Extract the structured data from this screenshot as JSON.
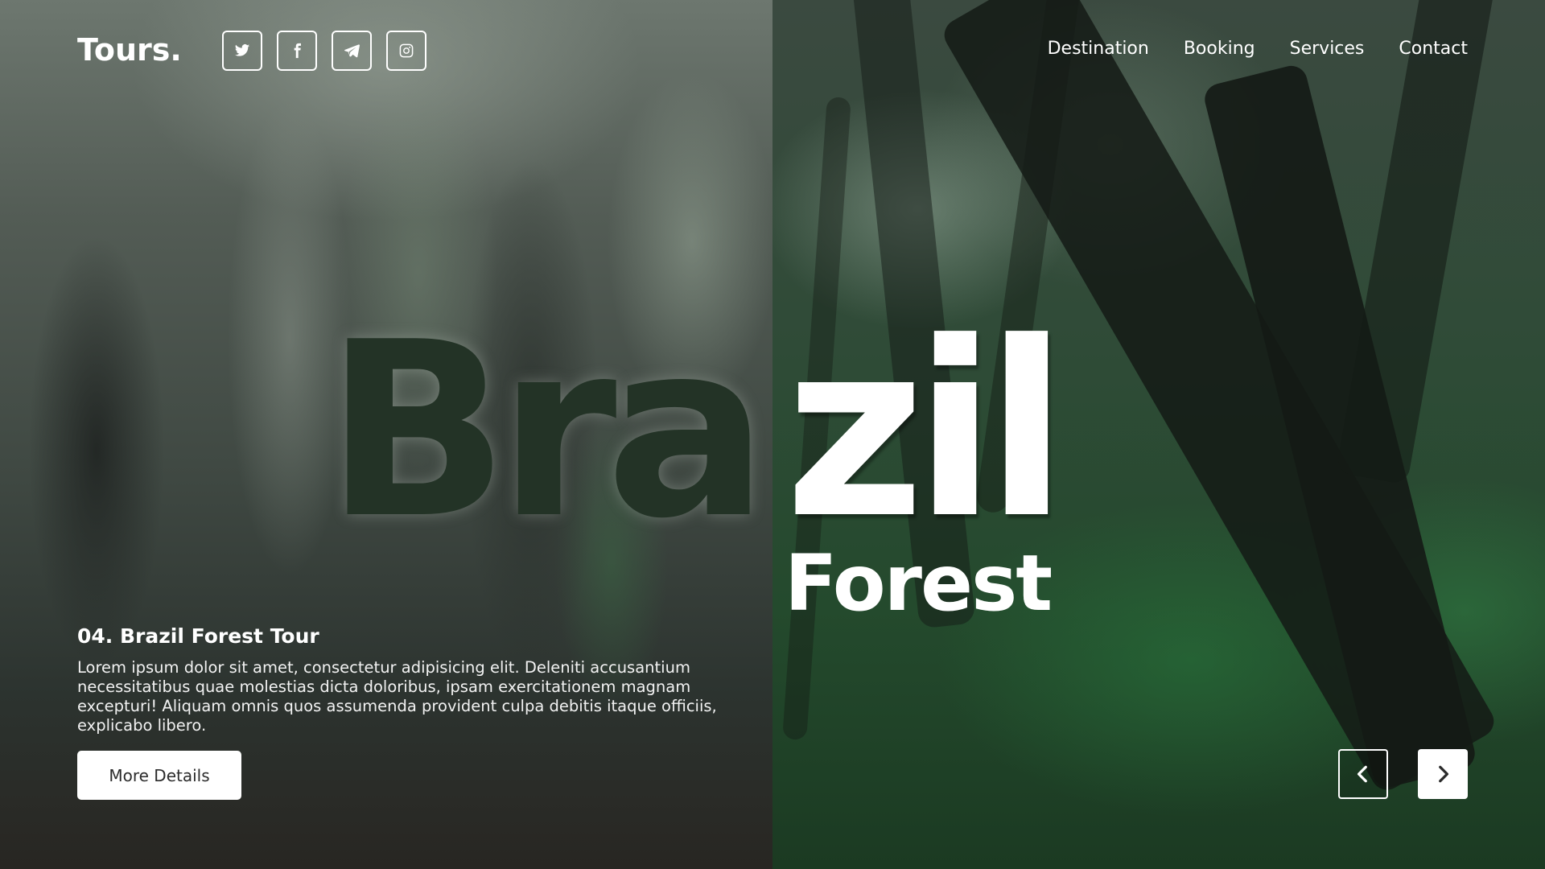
{
  "header": {
    "logo": "Tours.",
    "socials": [
      {
        "icon": "twitter-icon"
      },
      {
        "icon": "facebook-icon"
      },
      {
        "icon": "telegram-icon"
      },
      {
        "icon": "instagram-icon"
      }
    ],
    "nav": [
      "Destination",
      "Booking",
      "Services",
      "Contact"
    ]
  },
  "hero": {
    "title_left": "Bra",
    "title_right": "zil",
    "subtitle": "Forest"
  },
  "tour": {
    "heading": "04. Brazil Forest Tour",
    "description": "Lorem ipsum dolor sit amet, consectetur adipisicing elit. Deleniti accusantium necessitatibus quae molestias dicta doloribus, ipsam exercitationem magnam excepturi! Aliquam omnis quos assumenda provident culpa debitis itaque officiis, explicabo libero.",
    "button_label": "More Details"
  },
  "controls": {
    "prev_icon": "chevron-left-icon",
    "next_icon": "chevron-right-icon"
  },
  "colors": {
    "text": "#ffffff",
    "button_bg": "#ffffff",
    "button_text": "#2b2b2b"
  }
}
